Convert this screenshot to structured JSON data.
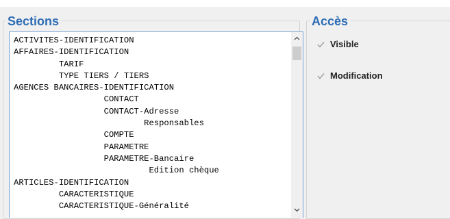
{
  "sections": {
    "title": "Sections",
    "items": [
      "ACTIVITES-IDENTIFICATION",
      "AFFAIRES-IDENTIFICATION",
      "         TARIF",
      "         TYPE TIERS / TIERS",
      "AGENCES BANCAIRES-IDENTIFICATION",
      "                  CONTACT",
      "                  CONTACT-Adresse",
      "                          Responsables",
      "                  COMPTE",
      "                  PARAMETRE",
      "                  PARAMETRE-Bancaire",
      "                           Edition chèque",
      "ARTICLES-IDENTIFICATION",
      "         CARACTERISTIQUE",
      "         CARACTERISTIQUE-Généralité"
    ]
  },
  "acces": {
    "title": "Accès",
    "visible": {
      "label": "Visible",
      "checked": true
    },
    "modification": {
      "label": "Modification",
      "checked": true
    }
  },
  "icons": {
    "scroll_up": "chevron-up-icon",
    "scroll_down": "chevron-down-icon",
    "check": "checkmark-icon"
  },
  "colors": {
    "legend": "#2e6cb5",
    "list_border": "#7aa3d6",
    "check_disabled": "#a0a0a0"
  }
}
